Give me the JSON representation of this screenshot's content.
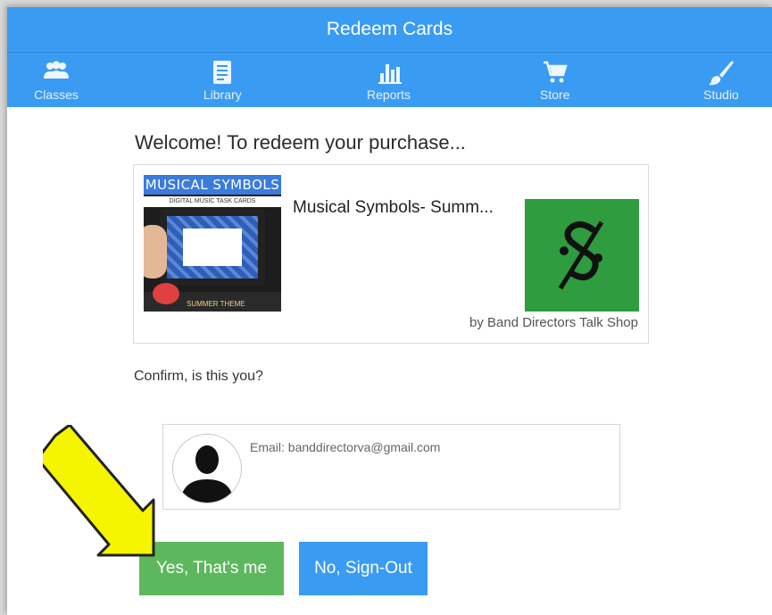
{
  "header": {
    "title": "Redeem Cards"
  },
  "nav": {
    "items": [
      {
        "label": "Classes",
        "icon": "people-icon"
      },
      {
        "label": "Library",
        "icon": "library-icon"
      },
      {
        "label": "Reports",
        "icon": "bar-chart-icon"
      },
      {
        "label": "Store",
        "icon": "cart-icon"
      },
      {
        "label": "Studio",
        "icon": "brush-icon"
      }
    ]
  },
  "main": {
    "heading": "Welcome! To redeem your purchase...",
    "product": {
      "name": "Musical Symbols- Summ...",
      "byline": "by Band Directors Talk Shop",
      "thumbnail_title": "MUSICAL SYMBOLS",
      "thumbnail_subtitle": "DIGITAL MUSIC TASK CARDS",
      "thumbnail_footer": "SUMMER THEME"
    },
    "confirm_text": "Confirm, is this you?",
    "user": {
      "email": "Email: banddirectorva@gmail.com"
    },
    "buttons": {
      "yes": "Yes, That's me",
      "no": "No, Sign-Out"
    }
  },
  "colors": {
    "header_blue": "#3a9bf2",
    "yes_green": "#5cb85c",
    "no_blue": "#3a9bf2",
    "logo_green": "#2e9c3f",
    "arrow_yellow": "#f5f500"
  }
}
